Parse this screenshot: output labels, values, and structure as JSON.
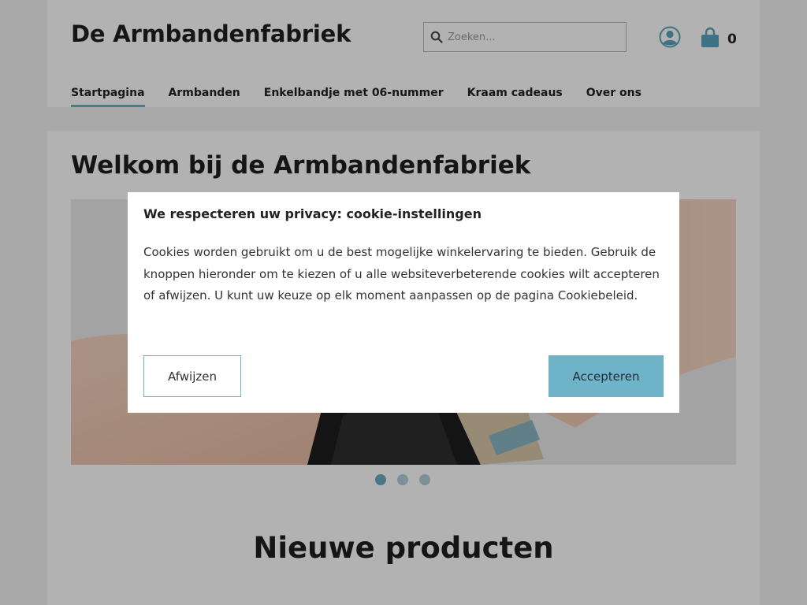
{
  "header": {
    "logo": "De Armbandenfabriek",
    "search_placeholder": "Zoeken...",
    "cart_count": "0",
    "nav": [
      {
        "label": "Startpagina",
        "active": true
      },
      {
        "label": "Armbanden"
      },
      {
        "label": "Enkelbandje met 06-nummer"
      },
      {
        "label": "Kraam cadeaus"
      },
      {
        "label": "Over ons"
      }
    ]
  },
  "main": {
    "welcome": "Welkom bij de Armbandenfabriek",
    "slider_active_index": 1,
    "slider_count": 3,
    "new_products": "Nieuwe producten"
  },
  "cookie_modal": {
    "title": "We respecteren uw privacy: cookie-instellingen",
    "body": "Cookies worden gebruikt om u de best mogelijke winkelervaring te bieden. Gebruik de knoppen hieronder om te kiezen of u alle websiteverbeterende cookies wilt accepteren of afwijzen. U kunt uw keuze op elk moment aanpassen op de pagina Cookiebeleid.",
    "decline_label": "Afwijzen",
    "accept_label": "Accepteren"
  },
  "colors": {
    "accent": "#6fb3c8",
    "overlay": "rgba(0,0,0,0.30)"
  }
}
